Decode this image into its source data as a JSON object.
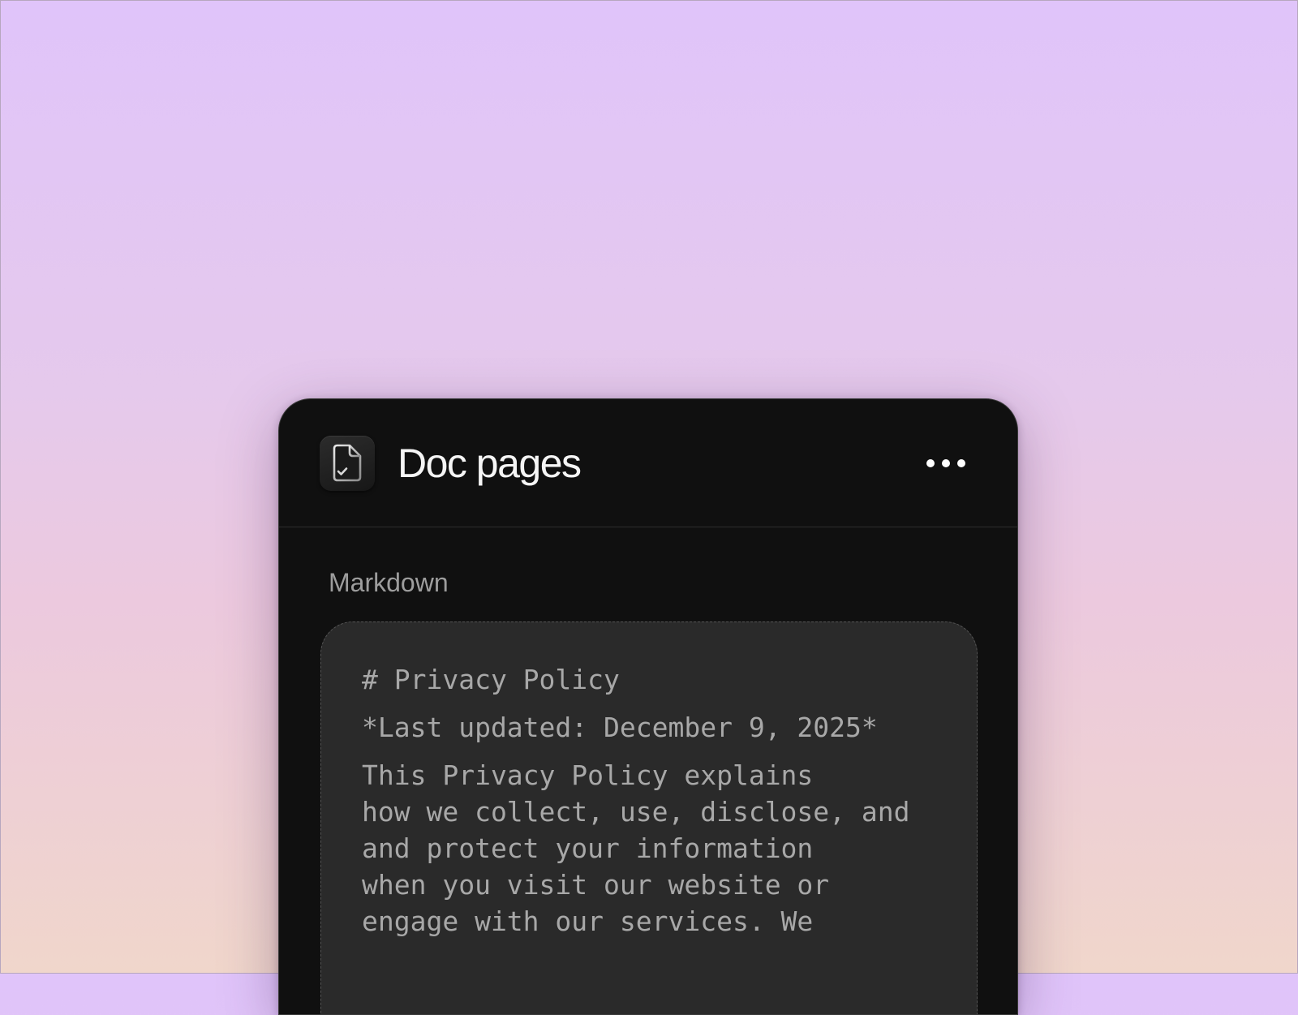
{
  "panel": {
    "title": "Doc pages",
    "app_icon": "document-check-icon",
    "more_icon": "more-horizontal-icon"
  },
  "section": {
    "label": "Markdown"
  },
  "editor": {
    "heading": "# Privacy Policy",
    "last_updated": "*Last updated: December 9, 2025*",
    "body_line_1": "This Privacy Policy explains",
    "body_line_2": "how we collect, use, disclose, and",
    "body_line_3": "and protect your information",
    "body_line_4": "when you visit our website or",
    "body_line_5": "engage with our services. We"
  },
  "colors": {
    "panel_bg": "#101010",
    "editor_bg": "#2a2a2a",
    "text_primary": "#f5f5f5",
    "text_muted": "#9d9d9d",
    "code_text": "#a8a8a8"
  }
}
